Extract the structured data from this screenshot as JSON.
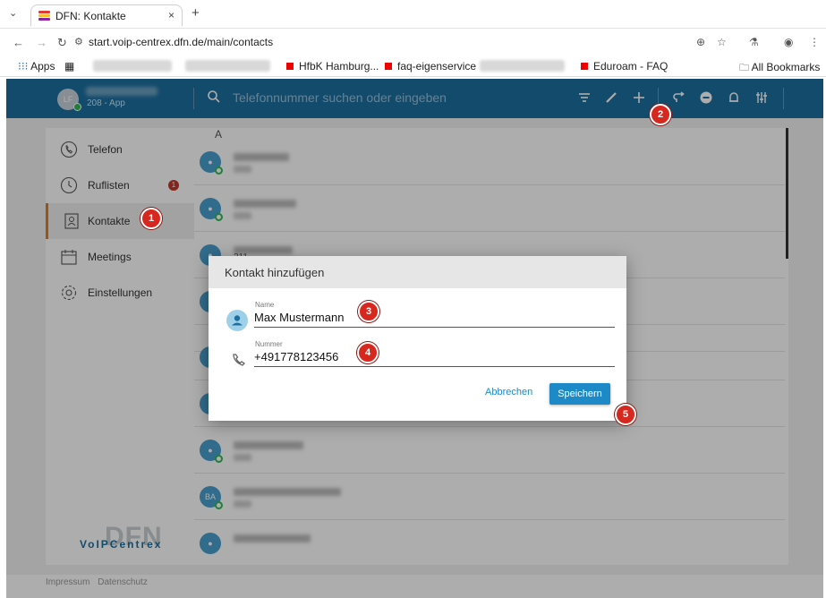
{
  "browser": {
    "tab_title": "DFN: Kontakte",
    "tab_close": "×",
    "new_tab": "+",
    "url": "start.voip-centrex.dfn.de/main/contacts",
    "bookmarks": {
      "apps": "Apps",
      "items": [
        "HfbK Hamburg...",
        "faq-eigenservice",
        "Eduroam - FAQ"
      ],
      "all": "All Bookmarks"
    }
  },
  "header": {
    "avatar_initials": "LF",
    "user_sub": "208 - App",
    "search_placeholder": "Telefonnummer suchen oder eingeben"
  },
  "sidebar": {
    "items": [
      {
        "label": "Telefon"
      },
      {
        "label": "Ruflisten",
        "badge": "1"
      },
      {
        "label": "Kontakte"
      },
      {
        "label": "Meetings"
      },
      {
        "label": "Einstellungen"
      }
    ],
    "logo_big": "DFN",
    "logo_text": "VoIPCentrex"
  },
  "contacts": {
    "section_letter": "A",
    "visible_number": "211",
    "ba_initials": "BA"
  },
  "footer": {
    "impressum": "Impressum",
    "datenschutz": "Datenschutz"
  },
  "modal": {
    "title": "Kontakt hinzufügen",
    "name_label": "Name",
    "name_value": "Max Mustermann",
    "number_label": "Nummer",
    "number_value": "+491778123456",
    "cancel_label": "Abbrechen",
    "save_label": "Speichern"
  },
  "markers": [
    "1",
    "2",
    "3",
    "4",
    "5"
  ],
  "colors": {
    "header_blue": "#1d6fa0",
    "accent_blue": "#1d8ac7",
    "active_orange": "#e07b21",
    "marker_red": "#d6281f",
    "online_green": "#2dbb55"
  }
}
